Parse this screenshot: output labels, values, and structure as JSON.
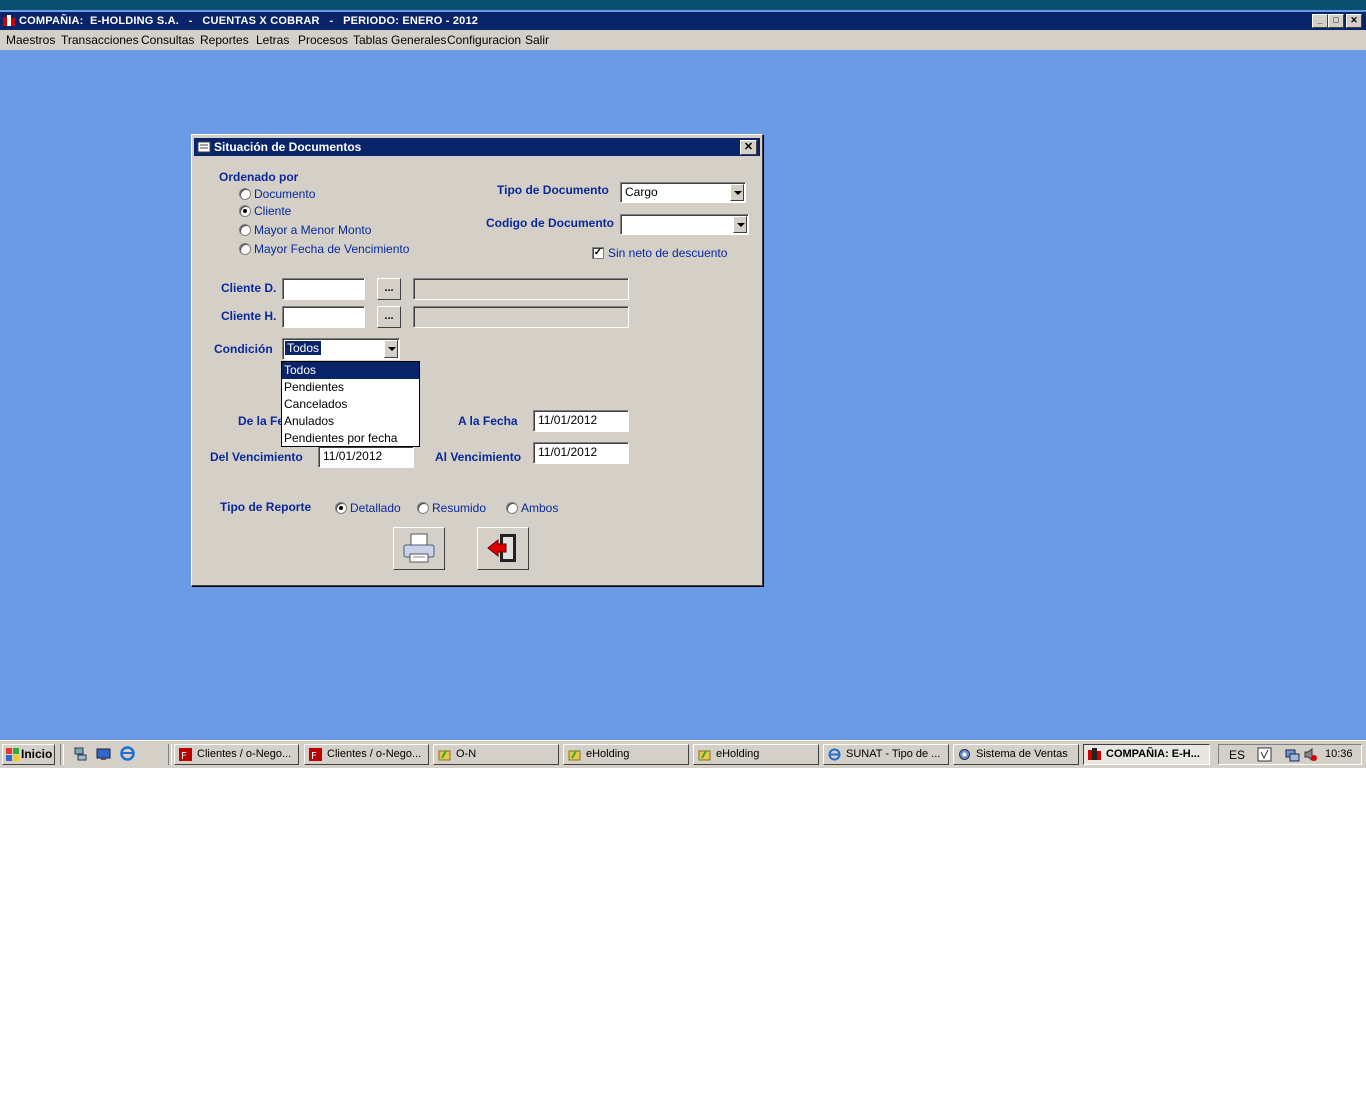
{
  "app": {
    "title": "COMPAÑIA:  E-HOLDING S.A.   -   CUENTAS X COBRAR   -   PERIODO: ENERO - 2012",
    "menu": [
      "Maestros",
      "Transacciones",
      "Consultas",
      "Reportes",
      "Letras",
      "Procesos",
      "Tablas Generales",
      "Configuracion",
      "Salir"
    ]
  },
  "dialog": {
    "title": "Situación de Documentos",
    "order_label": "Ordenado por",
    "order_options": [
      "Documento",
      "Cliente",
      "Mayor a Menor Monto",
      "Mayor Fecha de Vencimiento"
    ],
    "order_selected": "Cliente",
    "tipo_doc_label": "Tipo de Documento",
    "tipo_doc_value": "Cargo",
    "codigo_doc_label": "Codigo de Documento",
    "codigo_doc_value": "",
    "sin_neto_label": "Sin neto de descuento",
    "sin_neto_checked": true,
    "cliente_d_label": "Cliente D.",
    "cliente_h_label": "Cliente H.",
    "browse_label": "...",
    "condicion_label": "Condición",
    "condicion_value": "Todos",
    "condicion_options": [
      "Todos",
      "Pendientes",
      "Cancelados",
      "Anulados",
      "Pendientes por fecha"
    ],
    "de_fecha_label": "De la Fe",
    "a_fecha_label": "A la Fecha",
    "a_fecha_value": "11/01/2012",
    "del_venc_label": "Del Vencimiento",
    "del_venc_value": "11/01/2012",
    "al_venc_label": "Al Vencimiento",
    "al_venc_value": "11/01/2012",
    "tipo_reporte_label": "Tipo de Reporte",
    "tipo_reporte_options": [
      "Detallado",
      "Resumido",
      "Ambos"
    ],
    "tipo_reporte_selected": "Detallado"
  },
  "taskbar": {
    "start_label": "Inicio",
    "tasks": [
      "Clientes / o-Nego...",
      "Clientes / o-Nego...",
      "O-N",
      "eHolding",
      "eHolding",
      "SUNAT - Tipo de ...",
      "Sistema de Ventas",
      "COMPAÑIA:  E-H..."
    ],
    "lang": "ES",
    "clock": "10:36"
  }
}
